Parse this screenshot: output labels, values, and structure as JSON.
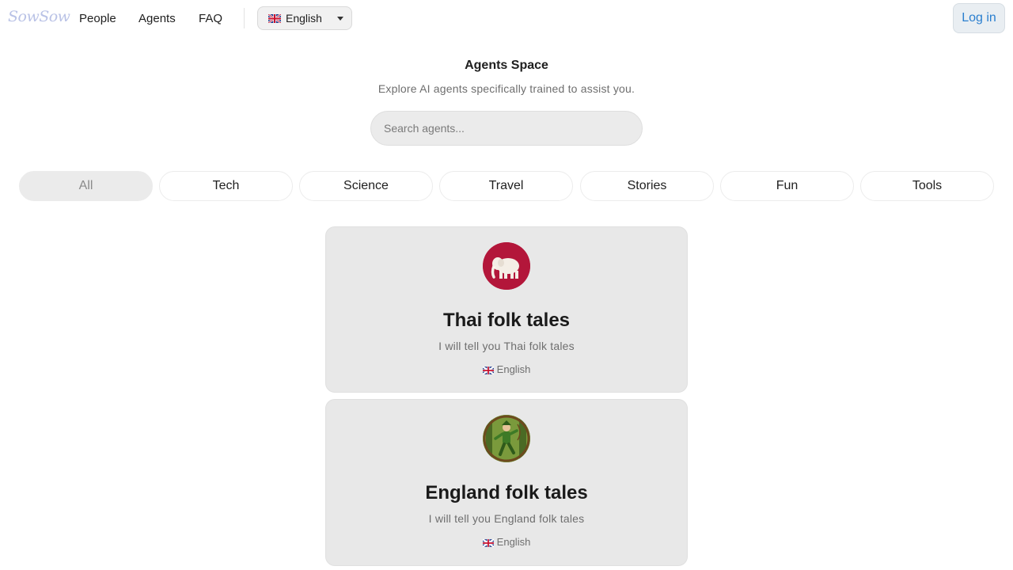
{
  "header": {
    "logo": "SowSow",
    "nav": [
      {
        "label": "People"
      },
      {
        "label": "Agents"
      },
      {
        "label": "FAQ"
      }
    ],
    "language": {
      "label": "English",
      "flag": "uk-flag-icon"
    },
    "login_label": "Log in"
  },
  "hero": {
    "title": "Agents Space",
    "subtitle": "Explore AI agents specifically trained to assist you.",
    "search_placeholder": "Search agents..."
  },
  "categories": [
    {
      "label": "All",
      "active": true
    },
    {
      "label": "Tech",
      "active": false
    },
    {
      "label": "Science",
      "active": false
    },
    {
      "label": "Travel",
      "active": false
    },
    {
      "label": "Stories",
      "active": false
    },
    {
      "label": "Fun",
      "active": false
    },
    {
      "label": "Tools",
      "active": false
    }
  ],
  "agents": [
    {
      "title": "Thai folk tales",
      "description": "I will tell you Thai folk tales",
      "language": "English",
      "avatar_icon": "white-elephant-icon",
      "avatar_color": "#b3163a"
    },
    {
      "title": "England folk tales",
      "description": "I will tell you England folk tales",
      "language": "English",
      "avatar_icon": "archer-in-forest-icon",
      "avatar_color": "#5b7d2d"
    }
  ],
  "colors": {
    "accent": "#2a7fcf",
    "card_bg": "#e8e8e8"
  }
}
